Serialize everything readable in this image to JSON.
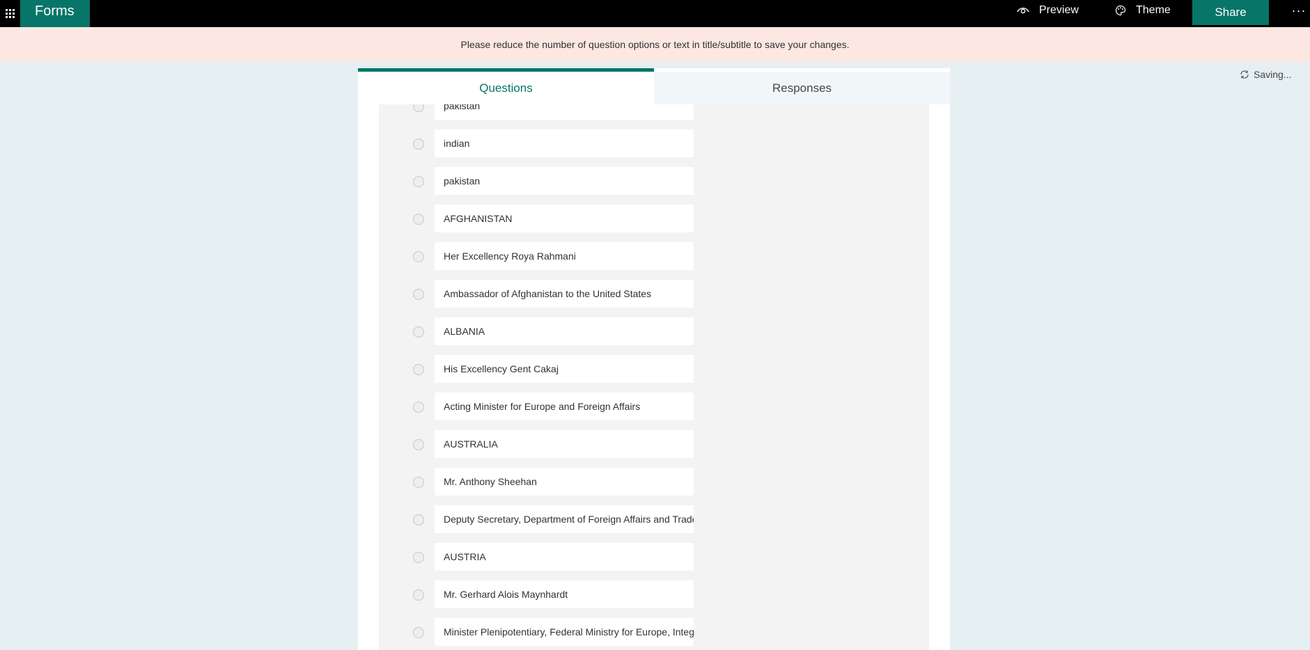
{
  "app": {
    "name": "Forms"
  },
  "toolbar": {
    "preview_label": "Preview",
    "theme_label": "Theme",
    "share_label": "Share",
    "more_label": "···"
  },
  "banner": {
    "message": "Please reduce the number of question options or text in title/subtitle to save your changes."
  },
  "status": {
    "saving_label": "Saving..."
  },
  "tabs": [
    {
      "label": "Questions",
      "active": true
    },
    {
      "label": "Responses",
      "active": false
    }
  ],
  "options": [
    "pakistan",
    "indian",
    "pakistan",
    "AFGHANISTAN",
    "Her Excellency Roya Rahmani",
    "Ambassador of Afghanistan to the United States",
    "ALBANIA",
    "His Excellency Gent Cakaj",
    "Acting Minister for Europe and Foreign Affairs",
    "AUSTRALIA",
    "Mr. Anthony Sheehan",
    "Deputy Secretary, Department of Foreign Affairs and Trade",
    "AUSTRIA",
    "Mr. Gerhard Alois Maynhardt",
    "Minister Plenipotentiary, Federal Ministry for Europe, Integration and Foreign Affairs"
  ],
  "colors": {
    "brand": "#077568",
    "topbar": "#000000",
    "banner": "#fde7e2",
    "page_bg": "#e6eff1"
  },
  "icons": {
    "waffle": "app-launcher-icon",
    "preview": "eye-icon",
    "theme": "palette-icon",
    "saving": "sync-icon"
  }
}
